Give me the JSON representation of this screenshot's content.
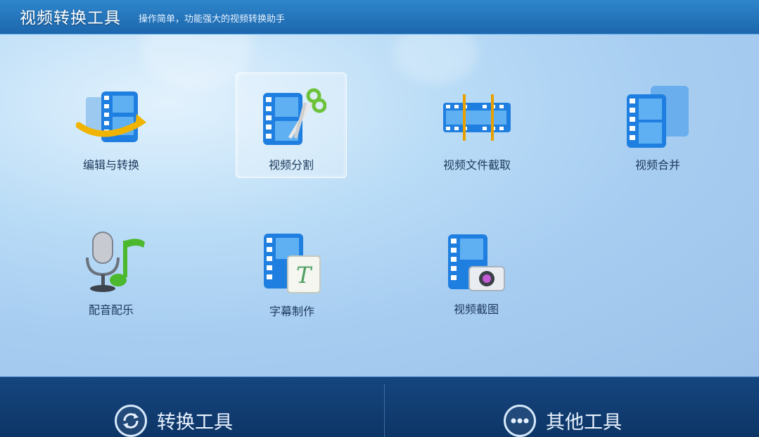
{
  "header": {
    "title": "视频转换工具",
    "subtitle": "操作简单，功能强大的视频转换助手"
  },
  "tools": [
    {
      "label": "编辑与转换",
      "icon": "film-convert-arrow-icon",
      "selected": false
    },
    {
      "label": "视频分割",
      "icon": "film-scissors-icon",
      "selected": true
    },
    {
      "label": "视频文件截取",
      "icon": "film-strip-crop-icon",
      "selected": false
    },
    {
      "label": "视频合并",
      "icon": "film-merge-icon",
      "selected": false
    },
    {
      "label": "配音配乐",
      "icon": "microphone-music-note-icon",
      "selected": false
    },
    {
      "label": "字幕制作",
      "icon": "film-subtitle-icon",
      "selected": false
    },
    {
      "label": "视频截图",
      "icon": "film-camera-icon",
      "selected": false
    }
  ],
  "bottom_nav": {
    "convert": {
      "label": "转换工具",
      "icon": "refresh-icon"
    },
    "other": {
      "label": "其他工具",
      "icon": "more-dots-icon"
    }
  },
  "colors": {
    "header": "#1c66ad",
    "bottom": "#0f3a6d",
    "film_blue": "#1f7fe0",
    "label_text": "#1d3a5c"
  }
}
